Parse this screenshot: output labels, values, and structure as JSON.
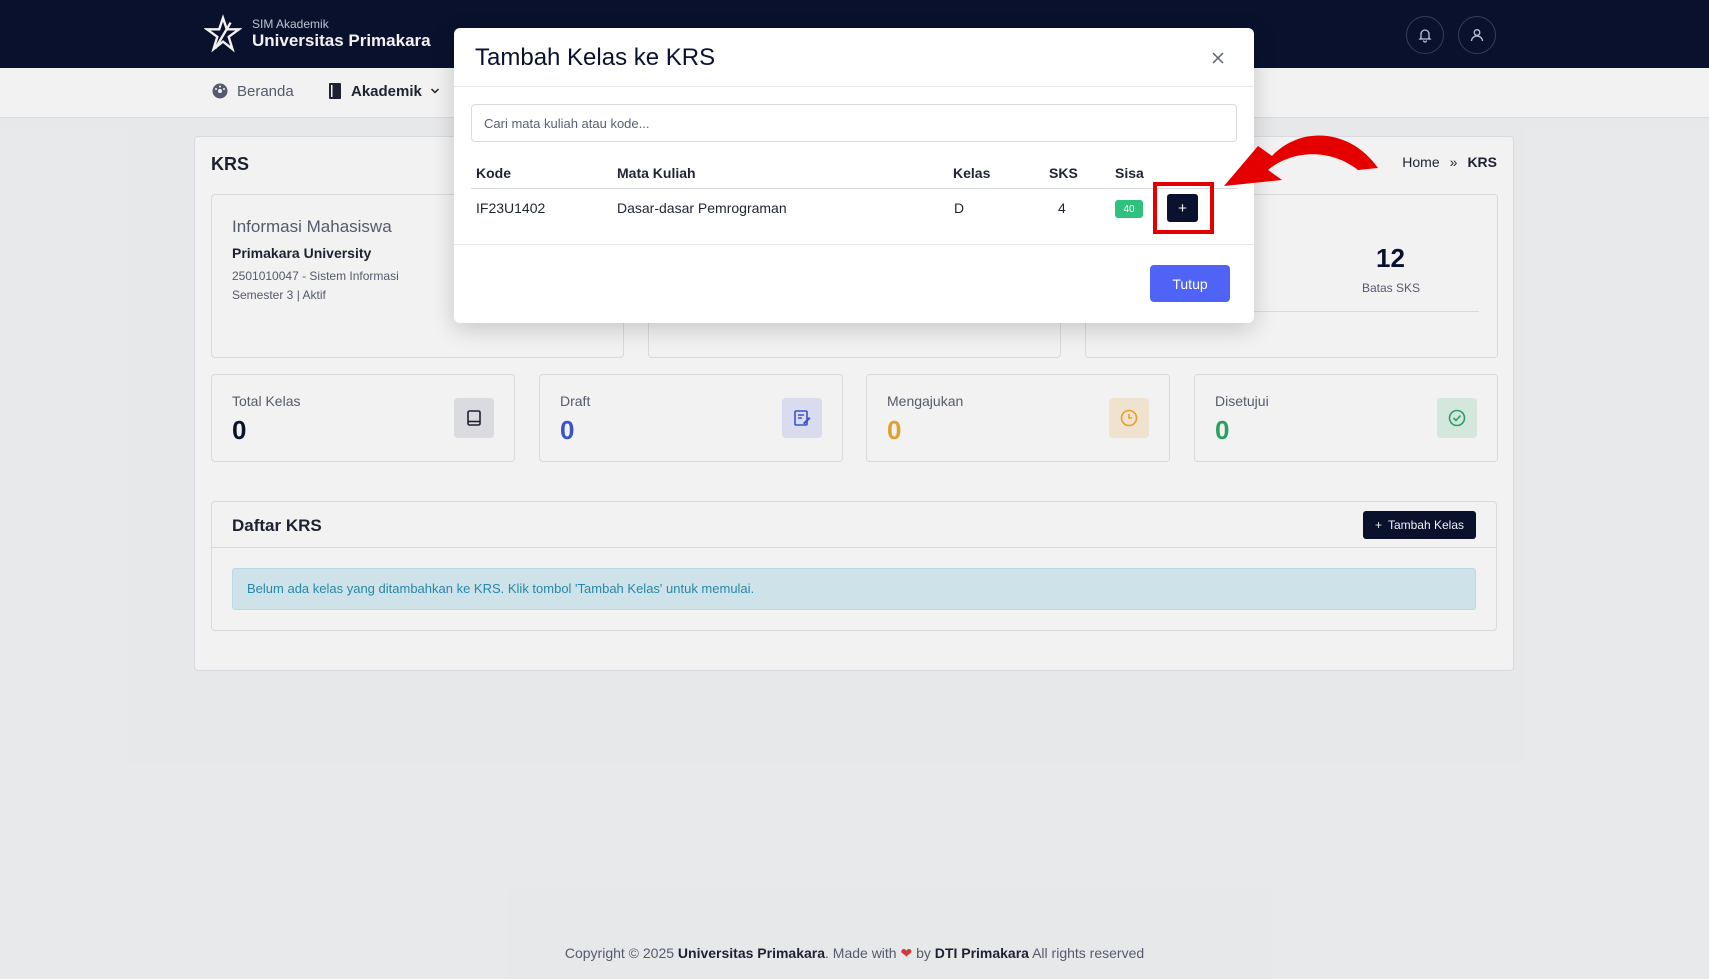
{
  "header": {
    "app_small": "SIM Akademik",
    "app_name": "Universitas Primakara"
  },
  "nav": {
    "home": "Beranda",
    "academic": "Akademik"
  },
  "page": {
    "title": "KRS",
    "breadcrumb_home": "Home",
    "breadcrumb_sep": "»",
    "breadcrumb_current": "KRS"
  },
  "student": {
    "section_title": "Informasi Mahasiswa",
    "name": "Primakara University",
    "id_program": "2501010047 - Sistem Informasi",
    "semester_status": "Semester 3 | Aktif"
  },
  "limits": {
    "batas_value": "12",
    "batas_label": "Batas SKS"
  },
  "stats": [
    {
      "label": "Total Kelas",
      "value": "0",
      "color": "#0b1230"
    },
    {
      "label": "Draft",
      "value": "0",
      "color": "#3f56d9"
    },
    {
      "label": "Mengajukan",
      "value": "0",
      "color": "#f0a830"
    },
    {
      "label": "Disetujui",
      "value": "0",
      "color": "#2ea868"
    }
  ],
  "daftar": {
    "title": "Daftar KRS",
    "add_button": "Tambah Kelas",
    "empty_alert": "Belum ada kelas yang ditambahkan ke KRS. Klik tombol 'Tambah Kelas' untuk memulai."
  },
  "footer": {
    "prefix": "Copyright © 2025",
    "org": "Universitas Primakara",
    "made_with": ". Made with",
    "by": "by",
    "team": "DTI Primakara",
    "rights": "All rights reserved"
  },
  "modal": {
    "title": "Tambah Kelas ke KRS",
    "search_placeholder": "Cari mata kuliah atau kode...",
    "columns": [
      "Kode",
      "Mata Kuliah",
      "Kelas",
      "SKS",
      "Sisa"
    ],
    "rows": [
      {
        "kode": "IF23U1402",
        "mata_kuliah": "Dasar-dasar Pemrograman",
        "kelas": "D",
        "sks": "4",
        "sisa": "40",
        "add": "+"
      }
    ],
    "close_button": "Tutup"
  },
  "colors": {
    "navy": "#0b1230",
    "primary": "#4f63f6",
    "success": "#2ec27e",
    "highlight": "#e50000"
  }
}
